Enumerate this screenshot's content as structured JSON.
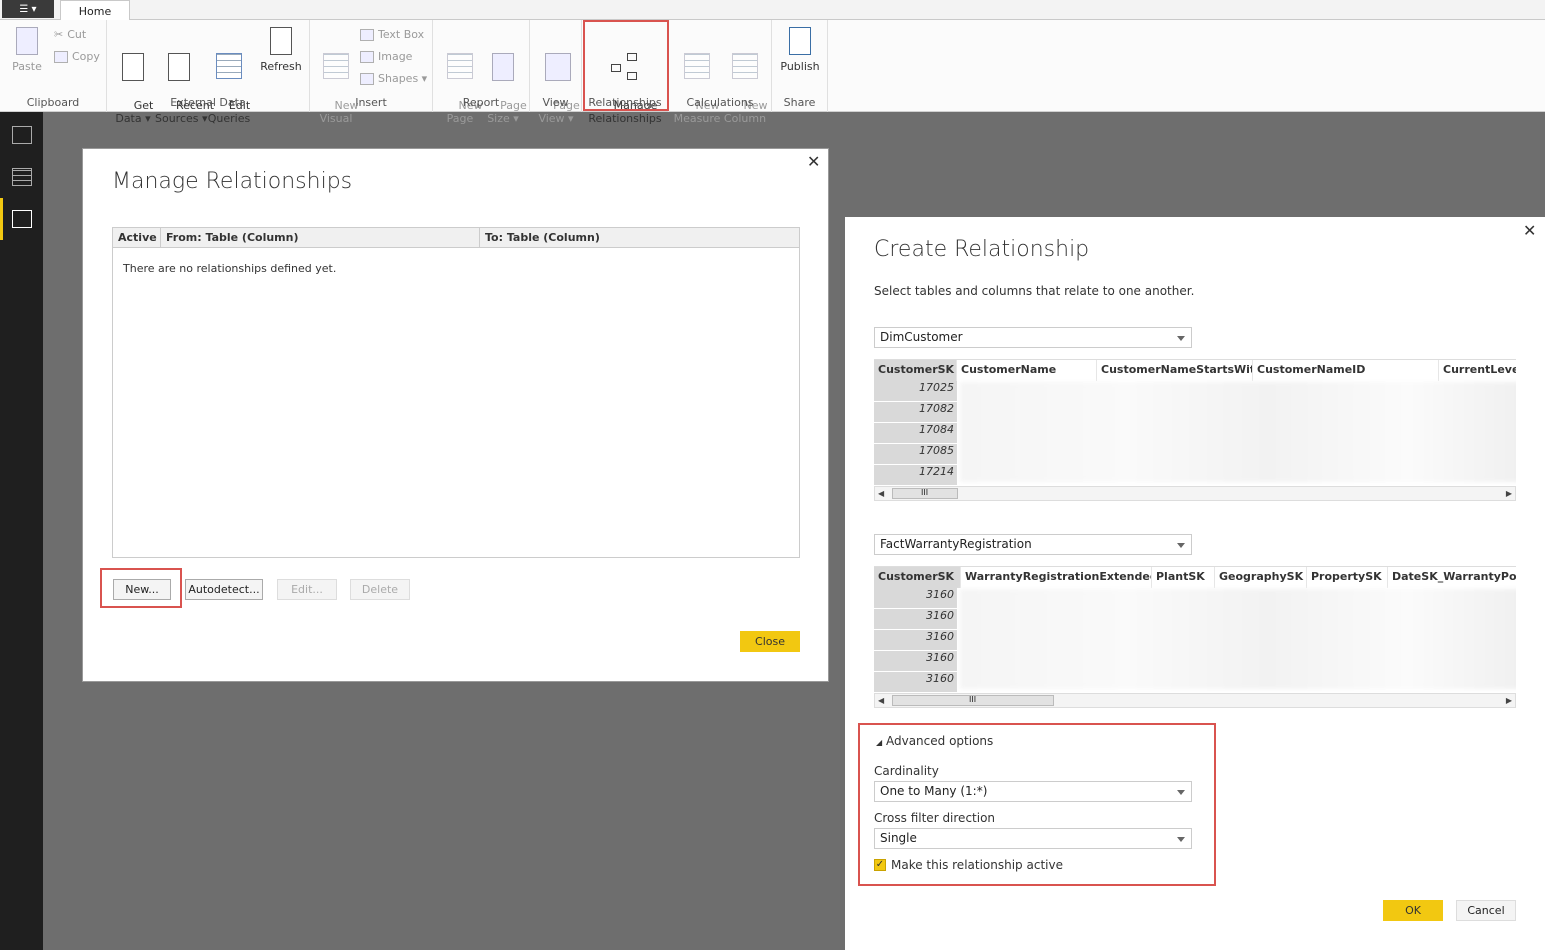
{
  "ribbon": {
    "home_tab": "Home",
    "groups": {
      "clipboard": {
        "label": "Clipboard",
        "paste": "Paste",
        "cut": "Cut",
        "copy": "Copy"
      },
      "external_data": {
        "label": "External Data",
        "get_data": "Get\nData ▾",
        "recent_sources": "Recent\nSources ▾",
        "edit_queries": "Edit\nQueries",
        "refresh": "Refresh"
      },
      "insert": {
        "label": "Insert",
        "new_visual": "New\nVisual",
        "text_box": "Text Box",
        "image": "Image",
        "shapes": "Shapes ▾"
      },
      "report": {
        "label": "Report",
        "new_page": "New\nPage",
        "page_size": "Page\nSize ▾"
      },
      "view": {
        "label": "View",
        "page_view": "Page\nView ▾"
      },
      "relationships": {
        "label": "Relationships",
        "manage": "Manage\nRelationships"
      },
      "calculations": {
        "label": "Calculations",
        "new_measure": "New\nMeasure",
        "new_column": "New\nColumn"
      },
      "share": {
        "label": "Share",
        "publish": "Publish"
      }
    }
  },
  "manage_dialog": {
    "title": "Manage Relationships",
    "columns": [
      "Active",
      "From: Table (Column)",
      "To: Table (Column)"
    ],
    "empty_message": "There are no relationships defined yet.",
    "buttons": {
      "new": "New...",
      "autodetect": "Autodetect...",
      "edit": "Edit...",
      "delete": "Delete",
      "close": "Close"
    }
  },
  "create_dialog": {
    "title": "Create Relationship",
    "subtitle": "Select tables and columns that relate to one another.",
    "table1": {
      "selected": "DimCustomer",
      "columns": [
        "CustomerSK",
        "CustomerName",
        "CustomerNameStartsWith",
        "CustomerNameID",
        "CurrentLevel"
      ],
      "keys": [
        "17025",
        "17082",
        "17084",
        "17085",
        "17214"
      ]
    },
    "table2": {
      "selected": "FactWarrantyRegistration",
      "columns": [
        "CustomerSK",
        "WarrantyRegistrationExtendedSK",
        "PlantSK",
        "GeographySK",
        "PropertySK",
        "DateSK_WarrantyPosted"
      ],
      "keys": [
        "3160",
        "3160",
        "3160",
        "3160",
        "3160"
      ]
    },
    "advanced": {
      "toggle_label": "Advanced options",
      "cardinality_label": "Cardinality",
      "cardinality_value": "One to Many (1:*)",
      "cross_filter_label": "Cross filter direction",
      "cross_filter_value": "Single",
      "active_label": "Make this relationship active",
      "active_checked": true
    },
    "buttons": {
      "ok": "OK",
      "cancel": "Cancel"
    },
    "scroll_grip": "III"
  },
  "colors": {
    "accent": "#f2c811",
    "highlight": "#d9534f"
  }
}
